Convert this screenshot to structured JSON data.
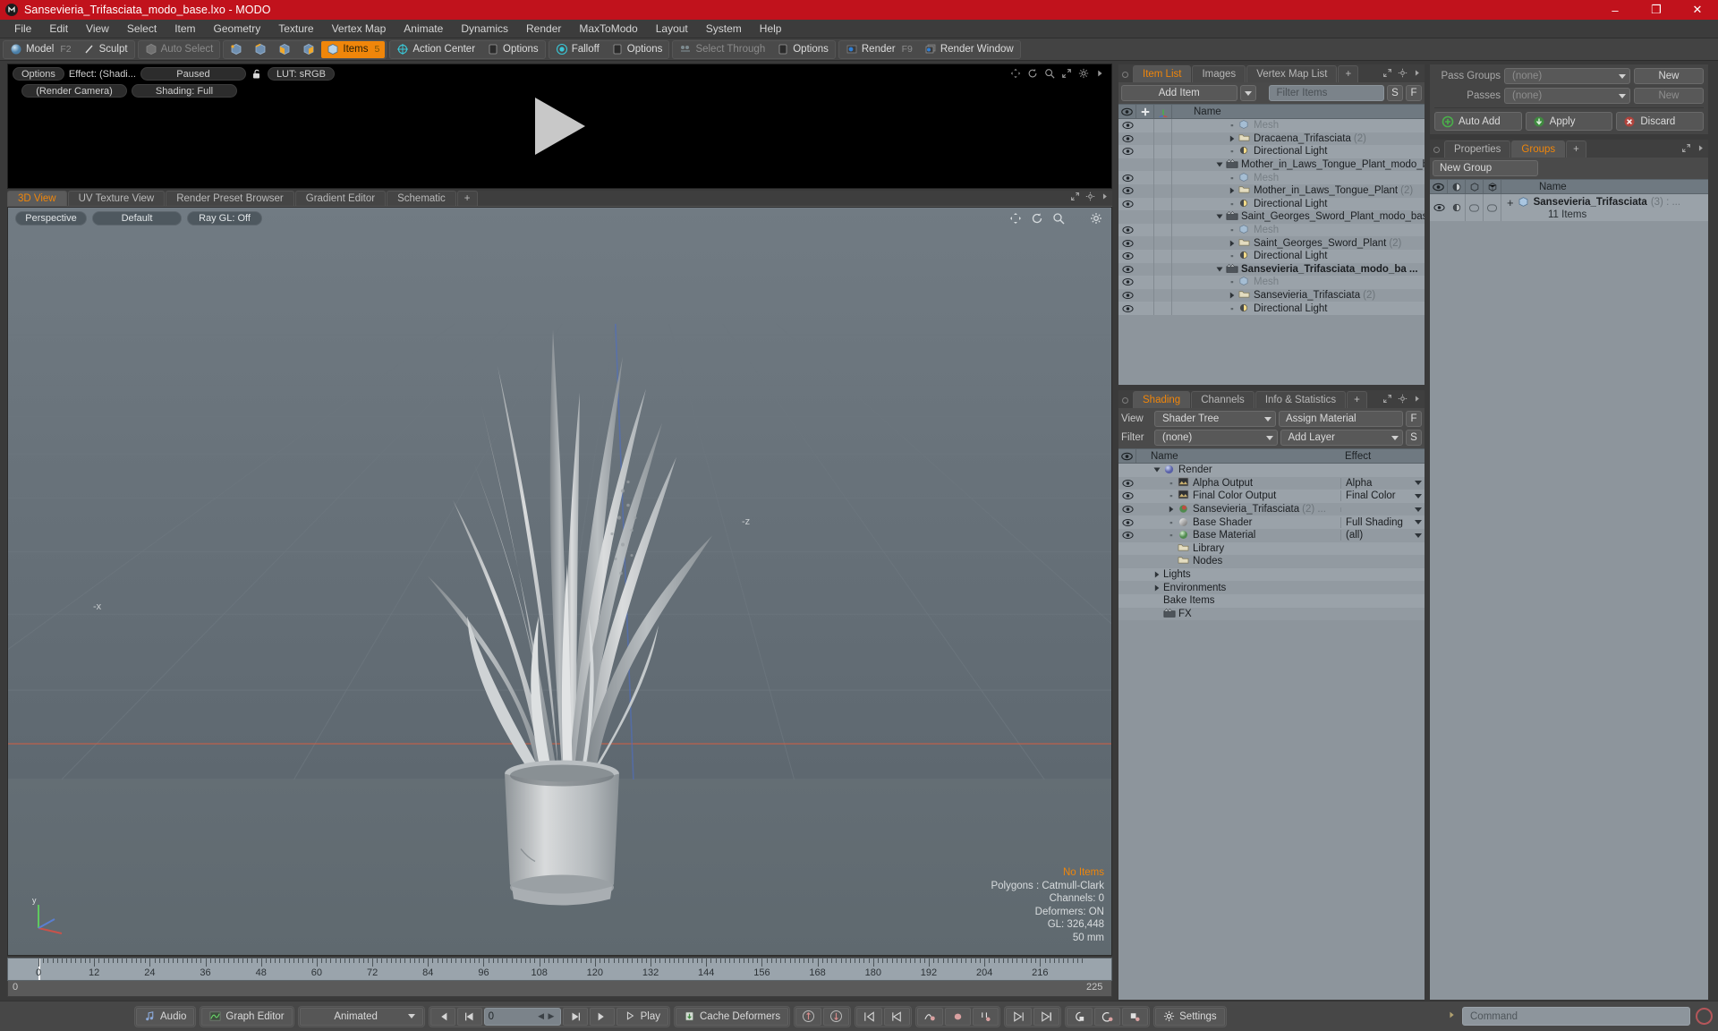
{
  "window": {
    "title": "Sansevieria_Trifasciata_modo_base.lxo - MODO",
    "logo": "modo-logo",
    "minimize": "–",
    "maximize": "❐",
    "close": "✕"
  },
  "menubar": {
    "items": [
      "File",
      "Edit",
      "View",
      "Select",
      "Item",
      "Geometry",
      "Texture",
      "Vertex Map",
      "Animate",
      "Dynamics",
      "Render",
      "MaxToModo",
      "Layout",
      "System",
      "Help"
    ]
  },
  "toolbar": {
    "group1": [
      {
        "label": "Model",
        "hint": "F2",
        "state": "normal",
        "icon": "sphere-icon"
      },
      {
        "label": "Sculpt",
        "hint": "",
        "state": "normal",
        "icon": "pen-icon"
      }
    ],
    "group2": [
      {
        "label": "Auto Select",
        "hint": "",
        "state": "dim",
        "icon": "cube-icon"
      }
    ],
    "selmodes": [
      "vertex-mode-icon",
      "edge-mode-icon",
      "polygon-mode-icon",
      "material-mode-icon"
    ],
    "items_button": {
      "label": "Items",
      "hint": "5",
      "state": "active",
      "icon": "cube-orange-icon"
    },
    "group3": [
      {
        "label": "Action Center",
        "hint": "",
        "state": "normal",
        "icon": "action-center-icon"
      },
      {
        "label": "Options",
        "hint": "",
        "state": "normal",
        "icon": "options-icon"
      }
    ],
    "group4": [
      {
        "label": "Falloff",
        "hint": "",
        "state": "normal",
        "icon": "falloff-icon"
      },
      {
        "label": "Options",
        "hint": "",
        "state": "normal",
        "icon": "options-icon"
      }
    ],
    "group5": [
      {
        "label": "Select Through",
        "hint": "",
        "state": "dim",
        "icon": "select-through-icon"
      },
      {
        "label": "Options",
        "hint": "",
        "state": "normal",
        "icon": "options-icon"
      }
    ],
    "group6": [
      {
        "label": "Render",
        "hint": "F9",
        "state": "normal",
        "icon": "render-icon"
      },
      {
        "label": "Render Window",
        "hint": "",
        "state": "normal",
        "icon": "render-window-icon"
      }
    ]
  },
  "render_preview": {
    "options_label": "Options",
    "effect_label": "Effect: (Shadi...",
    "paused_label": "Paused",
    "lock_icon": "unlock-icon",
    "lut_label": "LUT: sRGB",
    "camera_label": "(Render Camera)",
    "shading_label": "Shading: Full",
    "icons": [
      "pan-icon",
      "rotate-icon",
      "zoom-icon",
      "fit-icon",
      "gear-icon",
      "arrow-right-icon"
    ],
    "play_overlay": "play-triangle-icon"
  },
  "viewport": {
    "tabs": [
      {
        "label": "3D View",
        "selected": true
      },
      {
        "label": "UV Texture View",
        "selected": false
      },
      {
        "label": "Render Preset Browser",
        "selected": false
      },
      {
        "label": "Gradient Editor",
        "selected": false
      },
      {
        "label": "Schematic",
        "selected": false
      },
      {
        "label": "+",
        "selected": false
      }
    ],
    "sub_controls": [
      "Perspective",
      "Default",
      "Ray GL: Off"
    ],
    "icons": [
      "pan-icon",
      "rotate-icon",
      "zoom-icon",
      "gear-icon"
    ],
    "status": {
      "no_items": "No Items",
      "polygons": "Polygons : Catmull-Clark",
      "channels": "Channels: 0",
      "deformers": "Deformers: ON",
      "gl": "GL: 326,448",
      "scale": "50 mm"
    },
    "axis_labels": {
      "x": "-x",
      "z": "-z",
      "y": "y"
    }
  },
  "timeline": {
    "ticks": [
      0,
      12,
      24,
      36,
      48,
      60,
      72,
      84,
      96,
      108,
      120,
      132,
      144,
      156,
      168,
      180,
      192,
      204,
      216
    ],
    "playhead_frame": 0,
    "range_start": "0",
    "range_end": "225",
    "range_end_right": "225",
    "end_total": "225"
  },
  "bottombar": {
    "audio_label": "Audio",
    "graph_editor_label": "Graph Editor",
    "animated_label": "Animated",
    "frame_value": "0",
    "play_label": "Play",
    "cache_deformers_label": "Cache Deformers",
    "settings_label": "Settings",
    "command_placeholder": "Command",
    "icons": [
      "first-frame-icon",
      "prev-frame-icon",
      "next-frame-icon",
      "last-frame-icon",
      "play-icon",
      "key-up-icon",
      "key-down-icon",
      "set-key-start-icon",
      "set-key-prev-icon",
      "curve-key-icon",
      "ellipse-key-icon",
      "bone-key-icon",
      "next-key-icon",
      "last-key-icon",
      "link-a-icon",
      "link-b-icon",
      "link-c-icon",
      "gear-icon",
      "command-record-icon"
    ]
  },
  "item_list": {
    "tabs": [
      {
        "label": "Item List",
        "selected": true
      },
      {
        "label": "Images",
        "selected": false
      },
      {
        "label": "Vertex Map List",
        "selected": false
      },
      {
        "label": "+",
        "selected": false
      }
    ],
    "add_item_label": "Add Item",
    "filter_placeholder": "Filter Items",
    "btn_s": "S",
    "btn_f": "F",
    "columns": [
      "eye-column-icon",
      "lock-column-icon",
      "axis-column-icon",
      "Name"
    ],
    "rows": [
      {
        "name": "Mesh",
        "count": "",
        "indent": 2,
        "icon": "mesh-icon",
        "dim": true,
        "bold": false,
        "disc": "leaf",
        "eye": true
      },
      {
        "name": "Dracaena_Trifasciata",
        "count": "(2)",
        "indent": 2,
        "icon": "folder-icon",
        "dim": false,
        "bold": false,
        "disc": "collapsed",
        "eye": true
      },
      {
        "name": "Directional Light",
        "count": "",
        "indent": 2,
        "icon": "light-icon",
        "dim": false,
        "bold": false,
        "disc": "leaf",
        "eye": true
      },
      {
        "name": "Mother_in_Laws_Tongue_Plant_modo_b ...",
        "count": "",
        "indent": 1,
        "icon": "scene-icon",
        "dim": false,
        "bold": false,
        "disc": "expanded",
        "eye": false
      },
      {
        "name": "Mesh",
        "count": "",
        "indent": 2,
        "icon": "mesh-icon",
        "dim": true,
        "bold": false,
        "disc": "leaf",
        "eye": true
      },
      {
        "name": "Mother_in_Laws_Tongue_Plant",
        "count": "(2)",
        "indent": 2,
        "icon": "folder-icon",
        "dim": false,
        "bold": false,
        "disc": "collapsed",
        "eye": true
      },
      {
        "name": "Directional Light",
        "count": "",
        "indent": 2,
        "icon": "light-icon",
        "dim": false,
        "bold": false,
        "disc": "leaf",
        "eye": true
      },
      {
        "name": "Saint_Georges_Sword_Plant_modo_bas ...",
        "count": "",
        "indent": 1,
        "icon": "scene-icon",
        "dim": false,
        "bold": false,
        "disc": "expanded",
        "eye": false
      },
      {
        "name": "Mesh",
        "count": "",
        "indent": 2,
        "icon": "mesh-icon",
        "dim": true,
        "bold": false,
        "disc": "leaf",
        "eye": true
      },
      {
        "name": "Saint_Georges_Sword_Plant",
        "count": "(2)",
        "indent": 2,
        "icon": "folder-icon",
        "dim": false,
        "bold": false,
        "disc": "collapsed",
        "eye": true
      },
      {
        "name": "Directional Light",
        "count": "",
        "indent": 2,
        "icon": "light-icon",
        "dim": false,
        "bold": false,
        "disc": "leaf",
        "eye": true
      },
      {
        "name": "Sansevieria_Trifasciata_modo_ba ...",
        "count": "",
        "indent": 1,
        "icon": "scene-icon",
        "dim": false,
        "bold": true,
        "disc": "expanded",
        "eye": true
      },
      {
        "name": "Mesh",
        "count": "",
        "indent": 2,
        "icon": "mesh-icon",
        "dim": true,
        "bold": false,
        "disc": "leaf",
        "eye": true
      },
      {
        "name": "Sansevieria_Trifasciata",
        "count": "(2)",
        "indent": 2,
        "icon": "folder-icon",
        "dim": false,
        "bold": false,
        "disc": "collapsed",
        "eye": true
      },
      {
        "name": "Directional Light",
        "count": "",
        "indent": 2,
        "icon": "light-icon",
        "dim": false,
        "bold": false,
        "disc": "leaf",
        "eye": true
      }
    ]
  },
  "shading": {
    "tabs": [
      {
        "label": "Shading",
        "selected": true
      },
      {
        "label": "Channels",
        "selected": false
      },
      {
        "label": "Info & Statistics",
        "selected": false
      },
      {
        "label": "+",
        "selected": false
      }
    ],
    "view_label": "View",
    "view_value": "Shader Tree",
    "assign_material_label": "Assign Material",
    "btn_f": "F",
    "filter_label": "Filter",
    "filter_value": "(none)",
    "add_layer_label": "Add Layer",
    "btn_s": "S",
    "col_name": "Name",
    "col_effect": "Effect",
    "rows": [
      {
        "name": "Render",
        "effect": "",
        "indent": 1,
        "icon": "render-globe-icon",
        "disc": "expanded",
        "eye": false,
        "dropdown": false,
        "count": ""
      },
      {
        "name": "Alpha Output",
        "effect": "Alpha",
        "indent": 2,
        "icon": "output-icon",
        "disc": "leaf",
        "eye": true,
        "dropdown": true,
        "count": ""
      },
      {
        "name": "Final Color Output",
        "effect": "Final Color",
        "indent": 2,
        "icon": "output-icon",
        "disc": "leaf",
        "eye": true,
        "dropdown": true,
        "count": ""
      },
      {
        "name": "Sansevieria_Trifasciata",
        "effect": "",
        "indent": 2,
        "icon": "material-red-icon",
        "disc": "collapsed",
        "eye": true,
        "dropdown": true,
        "count": "(2) ..."
      },
      {
        "name": "Base Shader",
        "effect": "Full Shading",
        "indent": 2,
        "icon": "shader-icon",
        "disc": "leaf",
        "eye": true,
        "dropdown": true,
        "count": ""
      },
      {
        "name": "Base Material",
        "effect": "(all)",
        "indent": 2,
        "icon": "material-green-icon",
        "disc": "leaf",
        "eye": true,
        "dropdown": true,
        "count": ""
      },
      {
        "name": "Library",
        "effect": "",
        "indent": 2,
        "icon": "folder-icon",
        "disc": "none",
        "eye": false,
        "dropdown": false,
        "count": ""
      },
      {
        "name": "Nodes",
        "effect": "",
        "indent": 2,
        "icon": "folder-icon",
        "disc": "none",
        "eye": false,
        "dropdown": false,
        "count": ""
      },
      {
        "name": "Lights",
        "effect": "",
        "indent": 1,
        "icon": "none",
        "disc": "collapsed",
        "eye": false,
        "dropdown": false,
        "count": ""
      },
      {
        "name": "Environments",
        "effect": "",
        "indent": 1,
        "icon": "none",
        "disc": "collapsed",
        "eye": false,
        "dropdown": false,
        "count": ""
      },
      {
        "name": "Bake Items",
        "effect": "",
        "indent": 1,
        "icon": "none",
        "disc": "none",
        "eye": false,
        "dropdown": false,
        "count": ""
      },
      {
        "name": "FX",
        "effect": "",
        "indent": 1,
        "icon": "scene-icon",
        "disc": "none",
        "eye": false,
        "dropdown": false,
        "count": ""
      }
    ]
  },
  "passes": {
    "pass_groups_label": "Pass Groups",
    "pass_groups_value": "(none)",
    "pass_groups_new": "New",
    "passes_label": "Passes",
    "passes_value": "(none)",
    "passes_new": "New",
    "auto_add": "Auto Add",
    "apply": "Apply",
    "discard": "Discard"
  },
  "groups": {
    "tabs": [
      {
        "label": "Properties",
        "selected": false
      },
      {
        "label": "Groups",
        "selected": true
      },
      {
        "label": "+",
        "selected": false
      }
    ],
    "new_group_label": "New Group",
    "columns": [
      "eye-column-icon",
      "shade-column-icon",
      "wire-column-icon",
      "bbox-column-icon",
      "Name"
    ],
    "row": {
      "name": "Sansevieria_Trifasciata",
      "count": "(3) : ...",
      "subtitle": "11 Items",
      "plus": "+"
    }
  },
  "colors": {
    "title_bar": "#c1121c",
    "accent": "#f0860a",
    "panel_bg": "#4a4a4a",
    "tree_bg": "#8d959c",
    "viewport_bg": "#6a747c"
  }
}
